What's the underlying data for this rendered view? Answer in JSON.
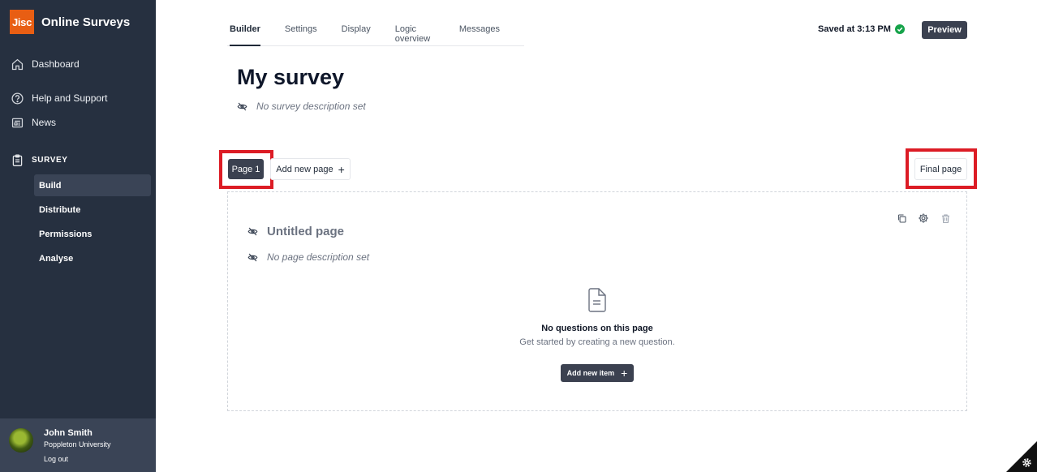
{
  "app": {
    "logo_text": "Jisc",
    "name": "Online Surveys"
  },
  "sidebar": {
    "nav": [
      {
        "label": "Dashboard",
        "icon": "home-icon"
      },
      {
        "label": "Help and Support",
        "icon": "help-icon"
      },
      {
        "label": "News",
        "icon": "news-icon"
      }
    ],
    "section_title": "SURVEY",
    "section_items": [
      {
        "label": "Build",
        "active": true
      },
      {
        "label": "Distribute",
        "active": false
      },
      {
        "label": "Permissions",
        "active": false
      },
      {
        "label": "Analyse",
        "active": false
      }
    ],
    "user": {
      "name": "John Smith",
      "org": "Poppleton University",
      "logout": "Log out"
    }
  },
  "tabs": [
    {
      "label": "Builder",
      "active": true
    },
    {
      "label": "Settings",
      "active": false
    },
    {
      "label": "Display",
      "active": false
    },
    {
      "label": "Logic overview",
      "active": false
    },
    {
      "label": "Messages",
      "active": false
    }
  ],
  "status": {
    "saved": "Saved at 3:13 PM"
  },
  "actions": {
    "preview": "Preview"
  },
  "survey": {
    "title": "My survey",
    "description": "No survey description set"
  },
  "pages": {
    "current": "Page 1",
    "add_new": "Add new page",
    "final": "Final page"
  },
  "page_panel": {
    "title": "Untitled page",
    "description": "No page description set",
    "empty_title": "No questions on this page",
    "empty_sub": "Get started by creating a new question.",
    "add_item": "Add new item"
  },
  "colors": {
    "sidebar": "#263040",
    "accent": "#e85e13",
    "highlight": "#dc1c25",
    "button": "#3b4150",
    "saved_check": "#16a34a"
  }
}
